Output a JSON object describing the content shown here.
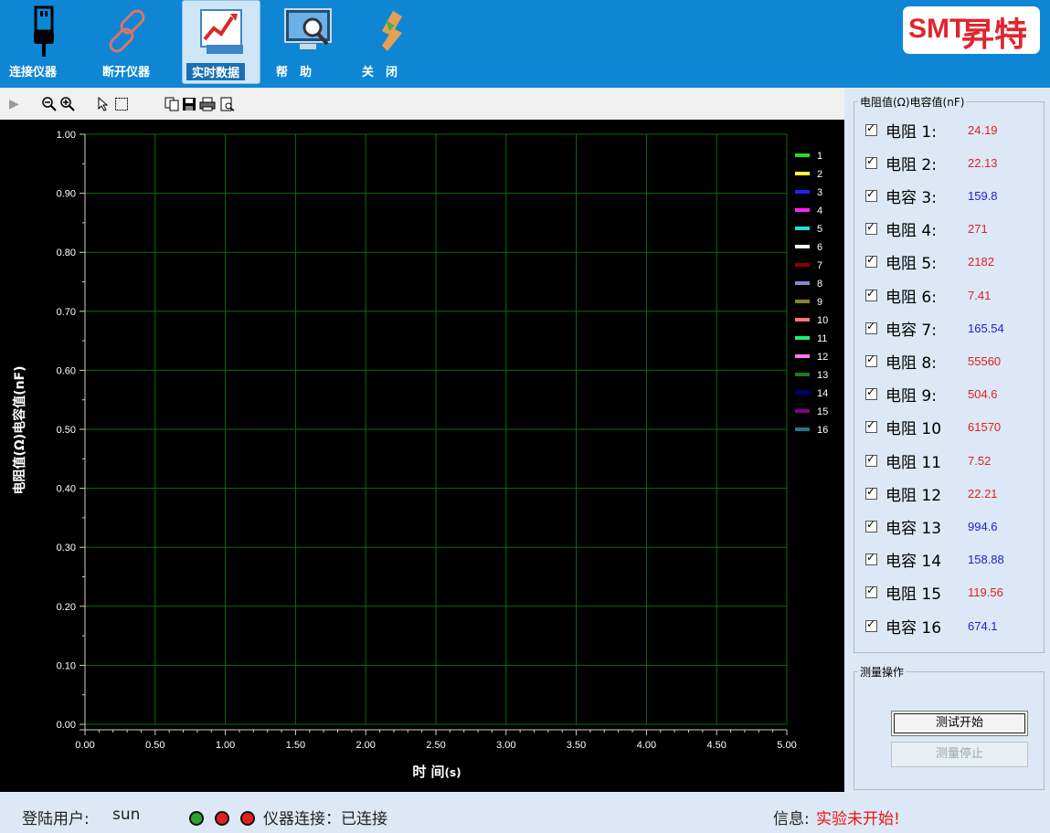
{
  "toolbar": {
    "buttons": [
      {
        "label": "连接仪器",
        "icon": "usb-plug-icon"
      },
      {
        "label": "断开仪器",
        "icon": "broken-link-icon"
      },
      {
        "label": "实时数据",
        "icon": "trend-chart-icon"
      },
      {
        "label": "帮　助",
        "icon": "monitor-magnifier-icon"
      },
      {
        "label": "关　闭",
        "icon": "close-hands-icon"
      }
    ],
    "logo_small": "SMT",
    "logo_text": "昇特"
  },
  "chart_toolbar": {
    "icons": [
      "play-arrow-icon",
      "zoom-out-icon",
      "zoom-in-icon",
      "pointer-icon",
      "select-rect-icon",
      "copy-icon",
      "save-icon",
      "print-icon",
      "print-preview-icon"
    ]
  },
  "chart_data": {
    "type": "line",
    "xlabel": "时 间",
    "xlabel_unit": "(s)",
    "ylabel": "电阻值(Ω)电容值(nF)",
    "xlim": [
      0,
      5
    ],
    "ylim": [
      0,
      1
    ],
    "x_ticks": [
      "0.00",
      "0.50",
      "1.00",
      "1.50",
      "2.00",
      "2.50",
      "3.00",
      "3.50",
      "4.00",
      "4.50",
      "5.00"
    ],
    "y_ticks": [
      "0.00",
      "0.10",
      "0.20",
      "0.30",
      "0.40",
      "0.50",
      "0.60",
      "0.70",
      "0.80",
      "0.90",
      "1.00"
    ],
    "grid": true,
    "legend_position": "right",
    "series": [
      {
        "name": "1",
        "color": "#22dd22",
        "values": []
      },
      {
        "name": "2",
        "color": "#ffff33",
        "values": []
      },
      {
        "name": "3",
        "color": "#2222ee",
        "values": []
      },
      {
        "name": "4",
        "color": "#ff22ff",
        "values": []
      },
      {
        "name": "5",
        "color": "#22dddd",
        "values": []
      },
      {
        "name": "6",
        "color": "#ffffff",
        "values": []
      },
      {
        "name": "7",
        "color": "#8b0000",
        "values": []
      },
      {
        "name": "8",
        "color": "#8888cc",
        "values": []
      },
      {
        "name": "9",
        "color": "#888822",
        "values": []
      },
      {
        "name": "10",
        "color": "#ff7777",
        "values": []
      },
      {
        "name": "11",
        "color": "#22ee77",
        "values": []
      },
      {
        "name": "12",
        "color": "#ff77ee",
        "values": []
      },
      {
        "name": "13",
        "color": "#227722",
        "values": []
      },
      {
        "name": "14",
        "color": "#000088",
        "values": []
      },
      {
        "name": "15",
        "color": "#880088",
        "values": []
      },
      {
        "name": "16",
        "color": "#227788",
        "values": []
      }
    ]
  },
  "readings": {
    "title": "电阻值(Ω)电容值(nF)",
    "items": [
      {
        "label": "电阻 1:",
        "value": "24.19",
        "color": "#e02020"
      },
      {
        "label": "电阻 2:",
        "value": "22.13",
        "color": "#e02020"
      },
      {
        "label": "电容 3:",
        "value": "159.8",
        "color": "#2020d0"
      },
      {
        "label": "电阻 4:",
        "value": "271",
        "color": "#e02020"
      },
      {
        "label": "电阻 5:",
        "value": "2182",
        "color": "#e02020"
      },
      {
        "label": "电阻 6:",
        "value": "7.41",
        "color": "#e02020"
      },
      {
        "label": "电容 7:",
        "value": "165.54",
        "color": "#2020d0"
      },
      {
        "label": "电阻 8:",
        "value": "55560",
        "color": "#e02020"
      },
      {
        "label": "电阻 9:",
        "value": "504.6",
        "color": "#e02020"
      },
      {
        "label": "电阻 10",
        "value": "61570",
        "color": "#e02020"
      },
      {
        "label": "电阻 11",
        "value": "7.52",
        "color": "#e02020"
      },
      {
        "label": "电阻 12",
        "value": "22.21",
        "color": "#e02020"
      },
      {
        "label": "电容 13",
        "value": "994.6",
        "color": "#2020d0"
      },
      {
        "label": "电容 14",
        "value": "158.88",
        "color": "#2020d0"
      },
      {
        "label": "电阻 15",
        "value": "119.56",
        "color": "#e02020"
      },
      {
        "label": "电容 16",
        "value": "674.1",
        "color": "#2020d0"
      }
    ]
  },
  "operations": {
    "title": "测量操作",
    "start_label": "测试开始",
    "stop_label": "测量停止"
  },
  "status": {
    "user_label": "登陆用户:",
    "user": "sun",
    "indicators": [
      "#2aa52a",
      "#e32020",
      "#e32020"
    ],
    "connection_text": "仪器连接：已连接",
    "info_label": "信息:",
    "info_text": "实验未开始!",
    "info_color": "#ee1111"
  }
}
